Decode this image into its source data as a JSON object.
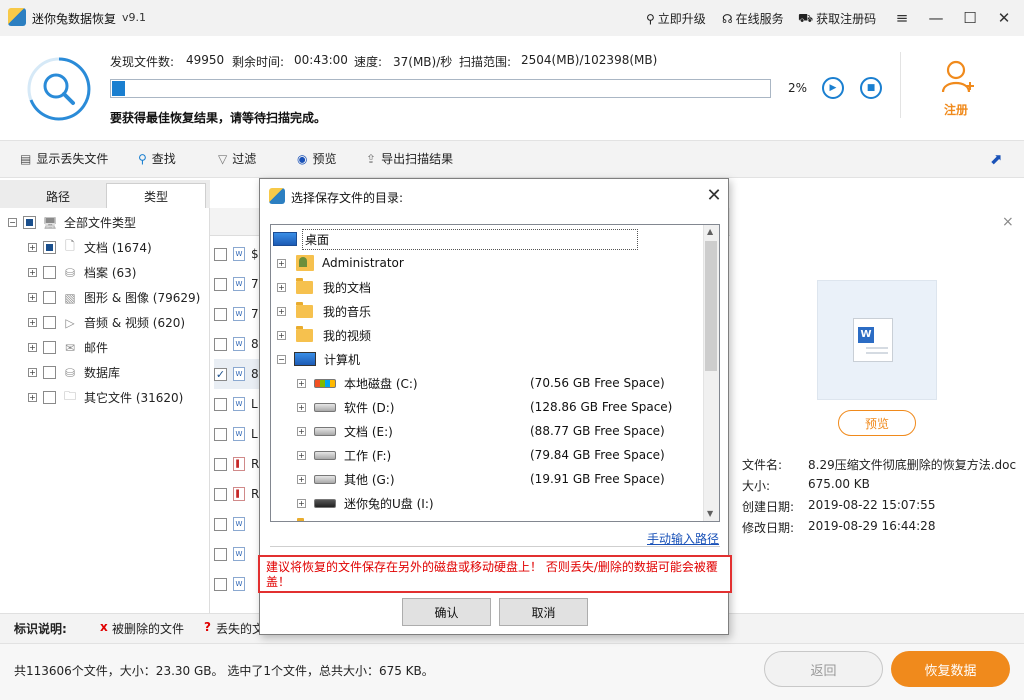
{
  "app": {
    "title": "迷你兔数据恢复",
    "version": "v9.1",
    "links": {
      "upgrade": "立即升级",
      "online_service": "在线服务",
      "get_code": "获取注册码"
    }
  },
  "scan": {
    "found_label": "发现文件数:",
    "found_value": "49950",
    "remaining_label": "剩余时间:",
    "remaining_value": "00:43:00",
    "speed_label": "速度:",
    "speed_value": "37(MB)/秒",
    "range_label": "扫描范围:",
    "range_value": "2504(MB)/102398(MB)",
    "progress_percent": 2,
    "progress_text": "2%",
    "hint": "要获得最佳恢复结果，请等待扫描完成。",
    "register_label": "注册"
  },
  "toolbar": {
    "show_lost": "显示丢失文件",
    "search": "查找",
    "filter": "过滤",
    "preview": "预览",
    "export": "导出扫描结果"
  },
  "tabs": {
    "path": "路径",
    "type": "类型"
  },
  "tree": [
    {
      "label": "全部文件类型",
      "icon": "computer-icon"
    },
    {
      "label": "文档 (1674)",
      "icon": "document-icon"
    },
    {
      "label": "档案 (63)",
      "icon": "archive-icon"
    },
    {
      "label": "图形 & 图像 (79629)",
      "icon": "image-icon"
    },
    {
      "label": "音频 & 视频 (620)",
      "icon": "media-icon"
    },
    {
      "label": "邮件",
      "icon": "mail-icon"
    },
    {
      "label": "数据库",
      "icon": "database-icon"
    },
    {
      "label": "其它文件 (31620)",
      "icon": "folder-icon"
    }
  ],
  "file_rows": [
    {
      "name": "$",
      "checked": false
    },
    {
      "name": "7",
      "checked": false
    },
    {
      "name": "7",
      "checked": false
    },
    {
      "name": "8",
      "checked": false
    },
    {
      "name": "8",
      "checked": true
    },
    {
      "name": "L",
      "checked": false
    },
    {
      "name": "L",
      "checked": false
    },
    {
      "name": "R",
      "checked": false
    },
    {
      "name": "R",
      "checked": false
    }
  ],
  "preview_panel": {
    "button": "预览",
    "filename_label": "文件名:",
    "filename_value": "8.29压缩文件彻底删除的恢复方法.doc",
    "size_label": "大小:",
    "size_value": "675.00 KB",
    "created_label": "创建日期:",
    "created_value": "2019-08-22 15:07:55",
    "modified_label": "修改日期:",
    "modified_value": "2019-08-29 16:44:28"
  },
  "legend": {
    "title": "标识说明:",
    "deleted_mark": "x",
    "deleted_label": "被删除的文件",
    "lost_mark": "?",
    "lost_label": "丢失的文"
  },
  "status": {
    "summary": "共113606个文件，大小：23.30 GB。 选中了1个文件，总共大小：675 KB。",
    "back": "返回",
    "recover": "恢复数据"
  },
  "dialog": {
    "title": "选择保存文件的目录:",
    "nodes": [
      {
        "label": "桌面",
        "space": ""
      },
      {
        "label": "Administrator",
        "space": ""
      },
      {
        "label": "我的文档",
        "space": ""
      },
      {
        "label": "我的音乐",
        "space": ""
      },
      {
        "label": "我的视频",
        "space": ""
      },
      {
        "label": "计算机",
        "space": ""
      },
      {
        "label": "本地磁盘 (C:)",
        "space": "(70.56 GB Free Space)"
      },
      {
        "label": "软件 (D:)",
        "space": "(128.86 GB Free Space)"
      },
      {
        "label": "文档 (E:)",
        "space": "(88.77 GB Free Space)"
      },
      {
        "label": "工作 (F:)",
        "space": "(79.84 GB Free Space)"
      },
      {
        "label": "其他 (G:)",
        "space": "(19.91 GB Free Space)"
      },
      {
        "label": "迷你兔的U盘 (I:)",
        "space": ""
      }
    ],
    "manual_input": "手动输入路径",
    "warning": "建议将恢复的文件保存在另外的磁盘或移动硬盘上！ 否则丢失/删除的数据可能会被覆盖！",
    "ok": "确认",
    "cancel": "取消"
  },
  "colors": {
    "accent": "#1a7fd0",
    "orange": "#f08a1c",
    "warning": "#e00000"
  }
}
